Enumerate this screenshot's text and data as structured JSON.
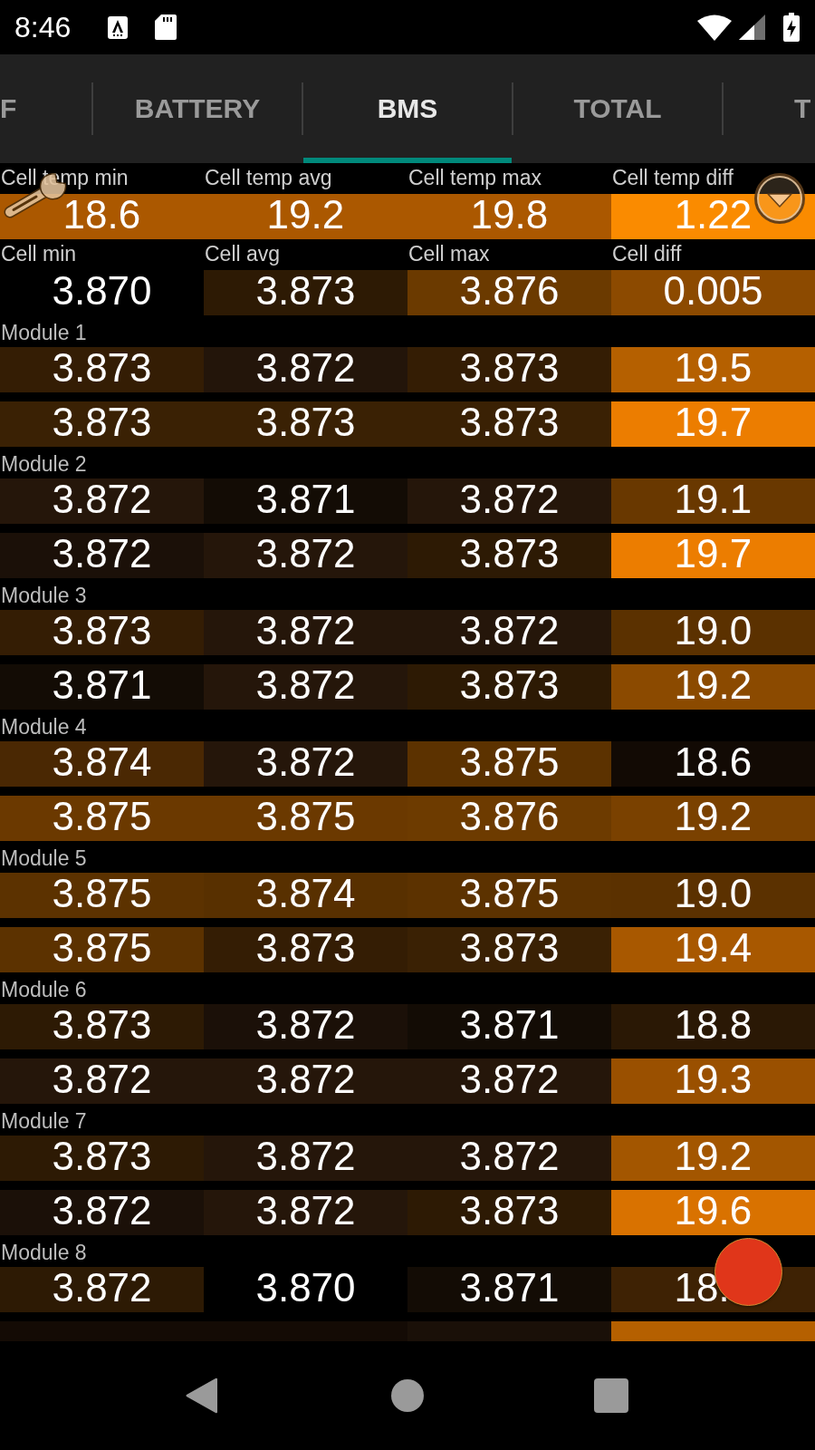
{
  "status_bar": {
    "time": "8:46"
  },
  "tabs": [
    {
      "label": "F",
      "selected": false
    },
    {
      "label": "BATTERY",
      "selected": false
    },
    {
      "label": "BMS",
      "selected": true
    },
    {
      "label": "TOTAL",
      "selected": false
    },
    {
      "label": "T",
      "selected": false
    }
  ],
  "summary": [
    {
      "labels": [
        "Cell temp min",
        "Cell temp avg",
        "Cell temp max",
        "Cell temp diff"
      ],
      "cells": [
        {
          "value": "18.6",
          "color": "#ab5800"
        },
        {
          "value": "19.2",
          "color": "#ab5800"
        },
        {
          "value": "19.8",
          "color": "#ab5800"
        },
        {
          "value": "1.22",
          "color": "#fa8b00"
        }
      ]
    },
    {
      "labels": [
        "Cell min",
        "Cell avg",
        "Cell max",
        "Cell diff"
      ],
      "cells": [
        {
          "value": "3.870",
          "color": "#000000"
        },
        {
          "value": "3.873",
          "color": "#2d1a04"
        },
        {
          "value": "3.876",
          "color": "#6b3a00"
        },
        {
          "value": "0.005",
          "color": "#8c4a00"
        }
      ]
    }
  ],
  "modules": [
    {
      "title": "Module 1",
      "rows": [
        [
          {
            "value": "3.873",
            "color": "#341d04"
          },
          {
            "value": "3.872",
            "color": "#23150a"
          },
          {
            "value": "3.873",
            "color": "#341d04"
          },
          {
            "value": "19.5",
            "color": "#b56000"
          }
        ],
        [
          {
            "value": "3.873",
            "color": "#3a2104"
          },
          {
            "value": "3.873",
            "color": "#3a2104"
          },
          {
            "value": "3.873",
            "color": "#3a2104"
          },
          {
            "value": "19.7",
            "color": "#ec7d00"
          }
        ]
      ]
    },
    {
      "title": "Module 2",
      "rows": [
        [
          {
            "value": "3.872",
            "color": "#25160a"
          },
          {
            "value": "3.871",
            "color": "#130c05"
          },
          {
            "value": "3.872",
            "color": "#25160a"
          },
          {
            "value": "19.1",
            "color": "#693800"
          }
        ],
        [
          {
            "value": "3.872",
            "color": "#1b1008"
          },
          {
            "value": "3.872",
            "color": "#25160a"
          },
          {
            "value": "3.873",
            "color": "#2d1a04"
          },
          {
            "value": "19.7",
            "color": "#ec7d00"
          }
        ]
      ]
    },
    {
      "title": "Module 3",
      "rows": [
        [
          {
            "value": "3.873",
            "color": "#341d04"
          },
          {
            "value": "3.872",
            "color": "#25160a"
          },
          {
            "value": "3.872",
            "color": "#25160a"
          },
          {
            "value": "19.0",
            "color": "#5b3100"
          }
        ],
        [
          {
            "value": "3.871",
            "color": "#130c05"
          },
          {
            "value": "3.872",
            "color": "#25160a"
          },
          {
            "value": "3.873",
            "color": "#2d1a04"
          },
          {
            "value": "19.2",
            "color": "#8b4a00"
          }
        ]
      ]
    },
    {
      "title": "Module 4",
      "rows": [
        [
          {
            "value": "3.874",
            "color": "#4a2803"
          },
          {
            "value": "3.872",
            "color": "#25160a"
          },
          {
            "value": "3.875",
            "color": "#5c3200"
          },
          {
            "value": "18.6",
            "color": "#120a04"
          }
        ],
        [
          {
            "value": "3.875",
            "color": "#6b3900"
          },
          {
            "value": "3.875",
            "color": "#6b3900"
          },
          {
            "value": "3.876",
            "color": "#6d3b00"
          },
          {
            "value": "19.2",
            "color": "#7a4100"
          }
        ]
      ]
    },
    {
      "title": "Module 5",
      "rows": [
        [
          {
            "value": "3.875",
            "color": "#5c3200"
          },
          {
            "value": "3.874",
            "color": "#583000"
          },
          {
            "value": "3.875",
            "color": "#5c3200"
          },
          {
            "value": "19.0",
            "color": "#5b3100"
          }
        ],
        [
          {
            "value": "3.875",
            "color": "#5c3200"
          },
          {
            "value": "3.873",
            "color": "#341d04"
          },
          {
            "value": "3.873",
            "color": "#3a2104"
          },
          {
            "value": "19.4",
            "color": "#a85800"
          }
        ]
      ]
    },
    {
      "title": "Module 6",
      "rows": [
        [
          {
            "value": "3.873",
            "color": "#2d1a04"
          },
          {
            "value": "3.872",
            "color": "#1b1008"
          },
          {
            "value": "3.871",
            "color": "#130c05"
          },
          {
            "value": "18.8",
            "color": "#2a1805"
          }
        ],
        [
          {
            "value": "3.872",
            "color": "#25160a"
          },
          {
            "value": "3.872",
            "color": "#25160a"
          },
          {
            "value": "3.872",
            "color": "#25160a"
          },
          {
            "value": "19.3",
            "color": "#9a5000"
          }
        ]
      ]
    },
    {
      "title": "Module 7",
      "rows": [
        [
          {
            "value": "3.873",
            "color": "#2d1a04"
          },
          {
            "value": "3.872",
            "color": "#25160a"
          },
          {
            "value": "3.872",
            "color": "#25160a"
          },
          {
            "value": "19.2",
            "color": "#a35600"
          }
        ],
        [
          {
            "value": "3.872",
            "color": "#1b1008"
          },
          {
            "value": "3.872",
            "color": "#25160a"
          },
          {
            "value": "3.873",
            "color": "#2d1a04"
          },
          {
            "value": "19.6",
            "color": "#d97200"
          }
        ]
      ]
    },
    {
      "title": "Module 8",
      "rows": [
        [
          {
            "value": "3.872",
            "color": "#2d1a04"
          },
          {
            "value": "3.870",
            "color": "#000000"
          },
          {
            "value": "3.871",
            "color": "#130c05"
          },
          {
            "value": "18.",
            "color": "#3e2204"
          }
        ],
        [
          {
            "color": "#140b05"
          },
          {
            "color": "#140b05"
          },
          {
            "color": "#1a1008"
          },
          {
            "color": "#b56000"
          }
        ]
      ]
    }
  ]
}
